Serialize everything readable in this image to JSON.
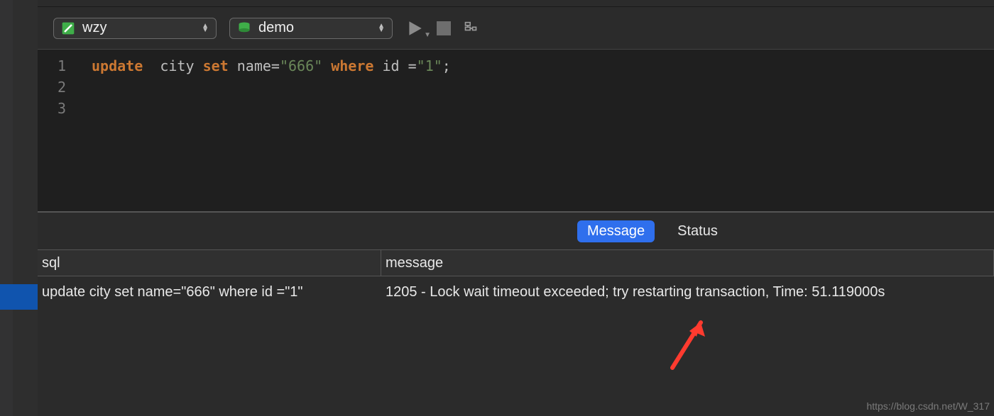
{
  "toolbar": {
    "connection": {
      "label": "wzy"
    },
    "database": {
      "label": "demo"
    },
    "icons": {
      "connection": "connection-icon",
      "database": "database-icon",
      "run": "play-icon",
      "stop": "stop-icon",
      "explain": "explain-icon"
    }
  },
  "editor": {
    "line_numbers": [
      "1",
      "2",
      "3"
    ],
    "line1": {
      "kw_update": "update",
      "tbl": "city",
      "kw_set": "set",
      "col": "name",
      "eq1": "=",
      "val1": "\"666\"",
      "kw_where": "where",
      "id_col": "id",
      "eq2": " =",
      "val2": "\"1\"",
      "semi": ";"
    }
  },
  "result_tabs": {
    "message": "Message",
    "status": "Status"
  },
  "grid": {
    "headers": {
      "sql": "sql",
      "message": "message"
    },
    "rows": [
      {
        "sql": "update  city set name=\"666\" where id =\"1\"",
        "message": "1205 - Lock wait timeout exceeded; try restarting transaction, Time: 51.119000s"
      }
    ]
  },
  "watermark": "https://blog.csdn.net/W_317"
}
